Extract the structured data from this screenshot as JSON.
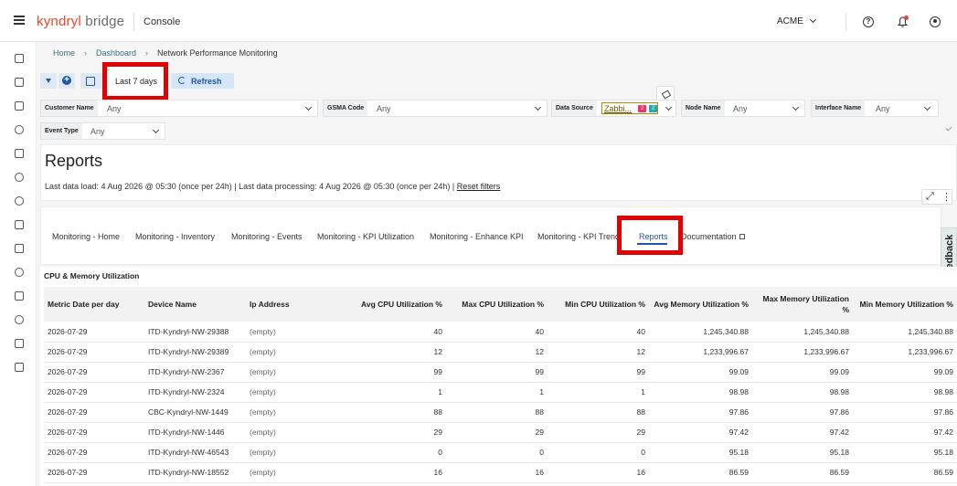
{
  "header": {
    "logo_brand": "kyndryl",
    "logo_product": "bridge",
    "app_name": "Console",
    "org": "ACME"
  },
  "breadcrumb": [
    "Home",
    "Dashboard",
    "Network Performance Monitoring"
  ],
  "toolbar": {
    "date_range": "Last 7 days",
    "refresh_label": "Refresh"
  },
  "filters": [
    {
      "label": "Customer Name",
      "value": "Any"
    },
    {
      "label": "GSMA Code",
      "value": "Any"
    },
    {
      "label": "Data Source",
      "value": "Zabbi...",
      "badges": [
        "2",
        "2"
      ]
    },
    {
      "label": "Node Name",
      "value": "Any"
    },
    {
      "label": "Interface Name",
      "value": "Any"
    },
    {
      "label": "Event Type",
      "value": "Any"
    }
  ],
  "reports": {
    "title": "Reports",
    "meta": "Last data load: 4 Aug 2026 @ 05:30 (once per 24h) | Last data processing: 4 Aug 2026 @ 05:30 (once per 24h) |",
    "reset_filters": "Reset filters"
  },
  "tabs": [
    "Monitoring - Home",
    "Monitoring - Inventory",
    "Monitoring - Events",
    "Monitoring - KPI Utilization",
    "Monitoring - Enhance KPI",
    "Monitoring - KPI Trend",
    "Reports",
    "Documentation"
  ],
  "active_tab": "Reports",
  "feedback_label": "Feedback",
  "table": {
    "title": "CPU & Memory Utilization",
    "columns": [
      "Metric Date per day",
      "Device Name",
      "Ip Address",
      "Avg CPU Utilization %",
      "Max CPU Utilization %",
      "Min CPU Utilization %",
      "Avg Memory Utilization %",
      "Max Memory Utilization %",
      "Min Memory Utilization %"
    ],
    "rows": [
      [
        "2026-07-29",
        "ITD-Kyndryl-NW-29388",
        "(empty)",
        "40",
        "40",
        "40",
        "1,245,340.88",
        "1,245,340.88",
        "1,245,340.88"
      ],
      [
        "2026-07-29",
        "ITD-Kyndryl-NW-29389",
        "(empty)",
        "12",
        "12",
        "12",
        "1,233,996.67",
        "1,233,996.67",
        "1,233,996.67"
      ],
      [
        "2026-07-29",
        "ITD-Kyndryl-NW-2367",
        "(empty)",
        "99",
        "99",
        "99",
        "99.09",
        "99.09",
        "99.09"
      ],
      [
        "2026-07-29",
        "ITD-Kyndryl-NW-2324",
        "(empty)",
        "1",
        "1",
        "1",
        "98.98",
        "98.98",
        "98.98"
      ],
      [
        "2026-07-29",
        "CBC-Kyndryl-NW-1449",
        "(empty)",
        "88",
        "88",
        "88",
        "97.86",
        "97.86",
        "97.86"
      ],
      [
        "2026-07-29",
        "ITD-Kyndryl-NW-1446",
        "(empty)",
        "29",
        "29",
        "29",
        "97.42",
        "97.42",
        "97.42"
      ],
      [
        "2026-07-29",
        "ITD-Kyndryl-NW-46543",
        "(empty)",
        "0",
        "0",
        "0",
        "95.18",
        "95.18",
        "95.18"
      ],
      [
        "2026-07-29",
        "ITD-Kyndryl-NW-18552",
        "(empty)",
        "16",
        "16",
        "16",
        "86.59",
        "86.59",
        "86.59"
      ]
    ]
  },
  "colors": {
    "brand": "#e8472f",
    "accent": "#1f56a8",
    "highlight": "#e30000"
  }
}
